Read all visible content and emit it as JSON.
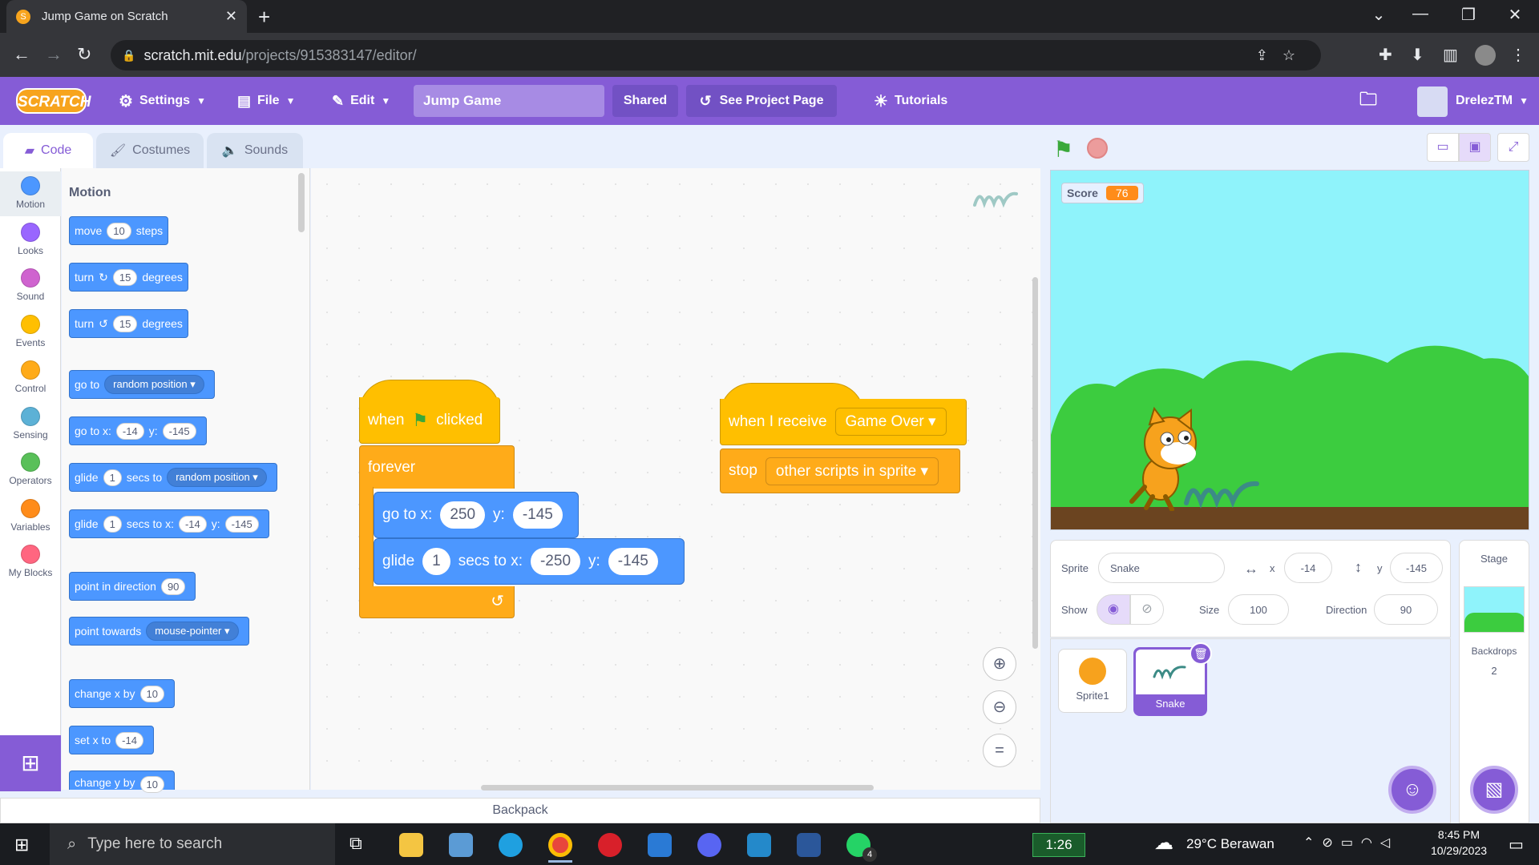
{
  "browser": {
    "tab_title": "Jump Game on Scratch",
    "url_host": "scratch.mit.edu",
    "url_path": "/projects/915383147/editor/"
  },
  "menubar": {
    "logo": "SCRATCH",
    "settings": "Settings",
    "file": "File",
    "edit": "Edit",
    "project_title": "Jump Game",
    "shared": "Shared",
    "see_project_page": "See Project Page",
    "tutorials": "Tutorials",
    "username": "DrelezTM"
  },
  "editor_tabs": [
    "Code",
    "Costumes",
    "Sounds"
  ],
  "categories": [
    {
      "label": "Motion",
      "color": "#4c97ff"
    },
    {
      "label": "Looks",
      "color": "#9966ff"
    },
    {
      "label": "Sound",
      "color": "#cf63cf"
    },
    {
      "label": "Events",
      "color": "#ffbf00"
    },
    {
      "label": "Control",
      "color": "#ffab19"
    },
    {
      "label": "Sensing",
      "color": "#5cb1d6"
    },
    {
      "label": "Operators",
      "color": "#59c059"
    },
    {
      "label": "Variables",
      "color": "#ff8c1a"
    },
    {
      "label": "My Blocks",
      "color": "#ff6680"
    }
  ],
  "palette": {
    "heading": "Motion",
    "move": {
      "a": "move",
      "v": "10",
      "b": "steps"
    },
    "turn_right": {
      "a": "turn",
      "v": "15",
      "b": "degrees"
    },
    "turn_left": {
      "a": "turn",
      "v": "15",
      "b": "degrees"
    },
    "goto": {
      "a": "go to",
      "dd": "random position"
    },
    "goto_xy": {
      "a": "go to x:",
      "x": "-14",
      "b": "y:",
      "y": "-145"
    },
    "glide_to": {
      "a": "glide",
      "v": "1",
      "b": "secs to",
      "dd": "random position"
    },
    "glide_xy": {
      "a": "glide",
      "v": "1",
      "b": "secs to x:",
      "x": "-14",
      "c": "y:",
      "y": "-145"
    },
    "point_dir": {
      "a": "point in direction",
      "v": "90"
    },
    "point_towards": {
      "a": "point towards",
      "dd": "mouse-pointer"
    },
    "change_x": {
      "a": "change x by",
      "v": "10"
    },
    "set_x": {
      "a": "set x to",
      "v": "-14"
    },
    "change_y": {
      "a": "change y by",
      "v": "10"
    }
  },
  "script1": {
    "when": "when",
    "clicked": "clicked",
    "forever": "forever",
    "goto_label": "go to x:",
    "goto_x": "250",
    "goto_y_label": "y:",
    "goto_y": "-145",
    "glide_label": "glide",
    "glide_secs": "1",
    "glide_to_label": "secs to x:",
    "glide_x": "-250",
    "glide_y_label": "y:",
    "glide_y": "-145"
  },
  "script2": {
    "when_receive": "when I receive",
    "message": "Game Over",
    "stop": "stop",
    "stop_option": "other scripts in sprite"
  },
  "backpack": "Backpack",
  "stage_monitor": {
    "label": "Score",
    "value": "76"
  },
  "sprite_info": {
    "sprite_label": "Sprite",
    "sprite_name": "Snake",
    "x_label": "x",
    "x": "-14",
    "y_label": "y",
    "y": "-145",
    "show_label": "Show",
    "size_label": "Size",
    "size": "100",
    "direction_label": "Direction",
    "direction": "90"
  },
  "sprites": [
    "Sprite1",
    "Snake"
  ],
  "stage_pane": {
    "title": "Stage",
    "backdrops_label": "Backdrops",
    "backdrops_count": "2"
  },
  "taskbar": {
    "search_placeholder": "Type here to search",
    "timer": "1:26",
    "weather": "29°C  Berawan",
    "time": "8:45 PM",
    "date": "10/29/2023",
    "whatsapp_badge": "4"
  }
}
